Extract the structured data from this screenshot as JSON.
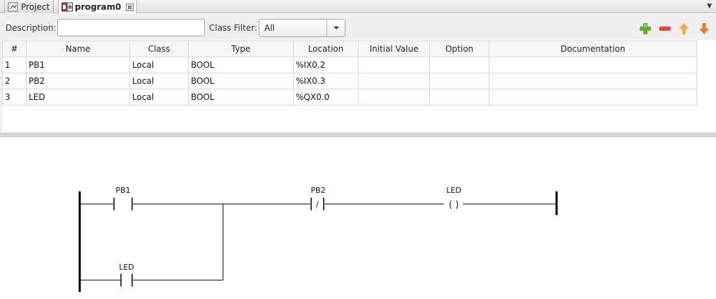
{
  "tabs": {
    "project": {
      "label": "Project"
    },
    "program": {
      "label": "program0",
      "close": "⊠"
    }
  },
  "filter": {
    "description_label": "Description:",
    "description_value": "",
    "class_filter_label": "Class Filter:",
    "class_filter_value": "All"
  },
  "table": {
    "columns": [
      "#",
      "Name",
      "Class",
      "Type",
      "Location",
      "Initial Value",
      "Option",
      "Documentation"
    ],
    "rows": [
      {
        "num": "1",
        "name": "PB1",
        "class": "Local",
        "type": "BOOL",
        "location": "%IX0.2",
        "initial": "",
        "option": "",
        "doc": ""
      },
      {
        "num": "2",
        "name": "PB2",
        "class": "Local",
        "type": "BOOL",
        "location": "%IX0.3",
        "initial": "",
        "option": "",
        "doc": ""
      },
      {
        "num": "3",
        "name": "LED",
        "class": "Local",
        "type": "BOOL",
        "location": "%QX0.0",
        "initial": "",
        "option": "",
        "doc": ""
      }
    ]
  },
  "ladder": {
    "contact_pb1": "PB1",
    "contact_pb2": "PB2",
    "contact_pb2_symbol": "/",
    "coil_led": "LED",
    "coil_symbol": "( )",
    "contact_led": "LED"
  },
  "colors": {
    "add": "#5cb02a",
    "remove": "#e0463a",
    "up": "#f5a94a",
    "down": "#f07722"
  }
}
